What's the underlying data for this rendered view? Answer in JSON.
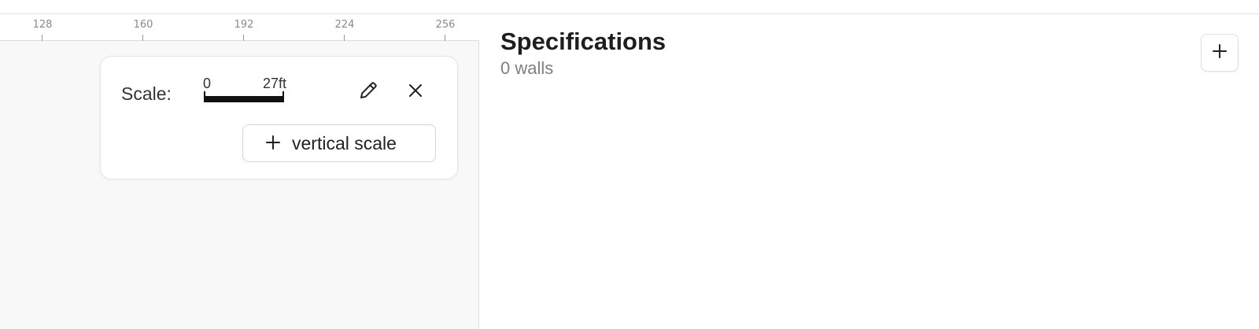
{
  "ruler": {
    "ticks": [
      "128",
      "160",
      "192",
      "224",
      "256"
    ]
  },
  "scale_card": {
    "label": "Scale:",
    "scale_start": "0",
    "scale_end": "27ft",
    "edit_icon": "pencil-icon",
    "close_icon": "close-icon",
    "add_vertical_scale_icon": "plus-icon",
    "add_vertical_scale_label": "vertical scale"
  },
  "specifications": {
    "title": "Specifications",
    "subtitle": "0 walls",
    "add_icon": "plus-icon"
  }
}
